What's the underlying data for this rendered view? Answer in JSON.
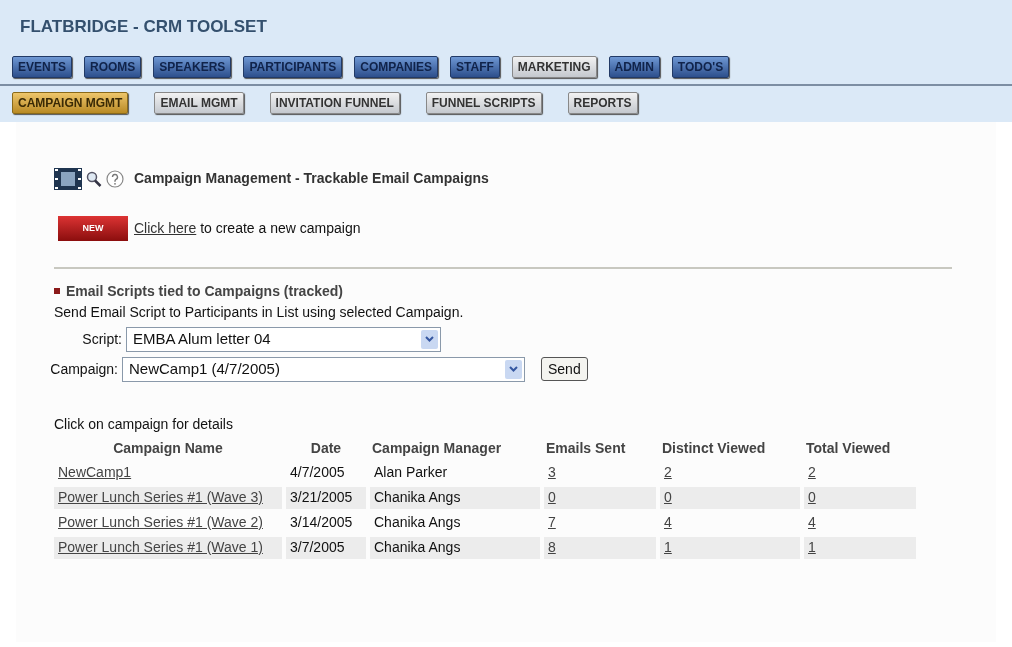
{
  "app_title": "FLATBRIDGE - CRM TOOLSET",
  "main_tabs": [
    {
      "label": "EVENTS",
      "kind": "module"
    },
    {
      "label": "ROOMS",
      "kind": "module"
    },
    {
      "label": "SPEAKERS",
      "kind": "module"
    },
    {
      "label": "PARTICIPANTS",
      "kind": "module"
    },
    {
      "label": "COMPANIES",
      "kind": "module"
    },
    {
      "label": "STAFF",
      "kind": "module"
    },
    {
      "label": "MARKETING",
      "kind": "current"
    },
    {
      "label": "ADMIN",
      "kind": "module"
    },
    {
      "label": "TODO'S",
      "kind": "module"
    }
  ],
  "sub_tabs": [
    {
      "label": "CAMPAIGN MGMT",
      "selected": true
    },
    {
      "label": "EMAIL MGMT",
      "selected": false
    },
    {
      "label": "INVITATION FUNNEL",
      "selected": false
    },
    {
      "label": "FUNNEL SCRIPTS",
      "selected": false
    },
    {
      "label": "REPORTS",
      "selected": false
    }
  ],
  "page_title": "Campaign Management - Trackable Email Campaigns",
  "new_badge": "NEW",
  "new_link": "Click here",
  "new_text": "to create a new campaign",
  "section_title": "Email Scripts tied to Campaigns (tracked)",
  "section_desc": "Send Email Script to Participants in List using selected Campaign.",
  "script_label": "Script:",
  "script_value": "EMBA Alum letter 04",
  "campaign_label": "Campaign:",
  "campaign_value": "NewCamp1 (4/7/2005)",
  "send_button": "Send",
  "table_caption": "Click on campaign for details",
  "table": {
    "columns": [
      "Campaign Name",
      "Date",
      "Campaign Manager",
      "Emails Sent",
      "Distinct Viewed",
      "Total Viewed"
    ],
    "rows": [
      [
        "NewCamp1",
        "4/7/2005",
        "Alan Parker",
        "3",
        "2",
        "2"
      ],
      [
        "Power Lunch Series #1 (Wave 3)",
        "3/21/2005",
        "Chanika Angs",
        "0",
        "0",
        "0"
      ],
      [
        "Power Lunch Series #1 (Wave 2)",
        "3/14/2005",
        "Chanika Angs",
        "7",
        "4",
        "4"
      ],
      [
        "Power Lunch Series #1 (Wave 1)",
        "3/7/2005",
        "Chanika Angs",
        "8",
        "1",
        "1"
      ]
    ]
  }
}
